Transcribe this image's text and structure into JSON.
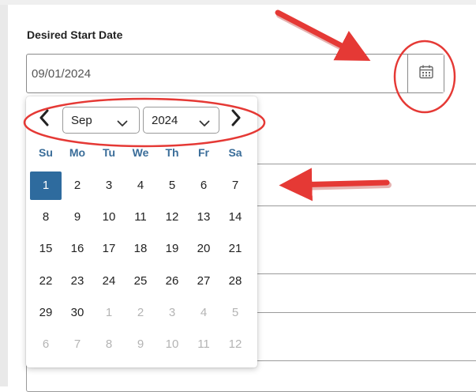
{
  "form": {
    "start_date_label": "Desired Start Date",
    "start_date_value": "09/01/2024"
  },
  "icons": {
    "calendar": "calendar-icon",
    "prev": "chevron-left-icon",
    "next": "chevron-right-icon",
    "dropdown": "chevron-down-icon"
  },
  "datepicker": {
    "month_selected": "Sep",
    "year_selected": "2024",
    "weekdays": [
      "Su",
      "Mo",
      "Tu",
      "We",
      "Th",
      "Fr",
      "Sa"
    ],
    "weeks": [
      [
        {
          "d": "1",
          "m": false,
          "sel": true
        },
        {
          "d": "2",
          "m": false
        },
        {
          "d": "3",
          "m": false
        },
        {
          "d": "4",
          "m": false
        },
        {
          "d": "5",
          "m": false
        },
        {
          "d": "6",
          "m": false
        },
        {
          "d": "7",
          "m": false
        }
      ],
      [
        {
          "d": "8",
          "m": false
        },
        {
          "d": "9",
          "m": false
        },
        {
          "d": "10",
          "m": false
        },
        {
          "d": "11",
          "m": false
        },
        {
          "d": "12",
          "m": false
        },
        {
          "d": "13",
          "m": false
        },
        {
          "d": "14",
          "m": false
        }
      ],
      [
        {
          "d": "15",
          "m": false
        },
        {
          "d": "16",
          "m": false
        },
        {
          "d": "17",
          "m": false
        },
        {
          "d": "18",
          "m": false
        },
        {
          "d": "19",
          "m": false
        },
        {
          "d": "20",
          "m": false
        },
        {
          "d": "21",
          "m": false
        }
      ],
      [
        {
          "d": "22",
          "m": false
        },
        {
          "d": "23",
          "m": false
        },
        {
          "d": "24",
          "m": false
        },
        {
          "d": "25",
          "m": false
        },
        {
          "d": "26",
          "m": false
        },
        {
          "d": "27",
          "m": false
        },
        {
          "d": "28",
          "m": false
        }
      ],
      [
        {
          "d": "29",
          "m": false
        },
        {
          "d": "30",
          "m": false
        },
        {
          "d": "1",
          "m": true
        },
        {
          "d": "2",
          "m": true
        },
        {
          "d": "3",
          "m": true
        },
        {
          "d": "4",
          "m": true
        },
        {
          "d": "5",
          "m": true
        }
      ],
      [
        {
          "d": "6",
          "m": true
        },
        {
          "d": "7",
          "m": true
        },
        {
          "d": "8",
          "m": true
        },
        {
          "d": "9",
          "m": true
        },
        {
          "d": "10",
          "m": true
        },
        {
          "d": "11",
          "m": true
        },
        {
          "d": "12",
          "m": true
        }
      ]
    ]
  },
  "colors": {
    "selected_day_bg": "#2e6b9e",
    "weekday_text": "#3a6d99",
    "annotation_red": "#e53935"
  }
}
